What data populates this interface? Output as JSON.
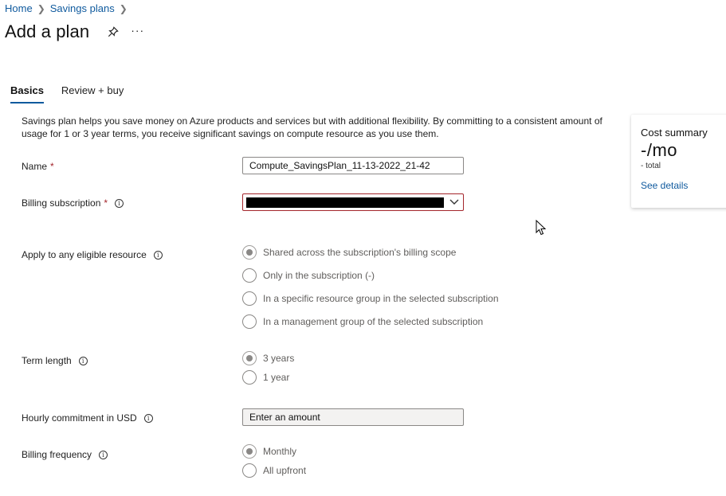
{
  "breadcrumb": [
    {
      "label": "Home"
    },
    {
      "label": "Savings plans"
    }
  ],
  "page": {
    "title": "Add a plan",
    "pin_icon": "pin-icon",
    "more_icon": "more-icon",
    "more_label": "···"
  },
  "tabs": [
    {
      "label": "Basics",
      "active": true
    },
    {
      "label": "Review + buy",
      "active": false
    }
  ],
  "intro": "Savings plan helps you save money on Azure products and services but with additional flexibility. By committing to a consistent amount of usage for 1 or 3 year terms, you receive significant savings on compute resource as you use them.",
  "form": {
    "name": {
      "label": "Name",
      "required_mark": "*",
      "value": "Compute_SavingsPlan_11-13-2022_21-42"
    },
    "billing_subscription": {
      "label": "Billing subscription",
      "required_mark": "*",
      "info_icon": "i",
      "value_redacted": true
    },
    "apply_scope": {
      "label": "Apply to any eligible resource",
      "info_icon": "i",
      "options": [
        {
          "label": "Shared across the subscription's billing scope",
          "checked": true
        },
        {
          "label": "Only in the subscription (-)",
          "checked": false
        },
        {
          "label": "In a specific resource group in the selected subscription",
          "checked": false
        },
        {
          "label": "In a management group of the selected subscription",
          "checked": false
        }
      ]
    },
    "term_length": {
      "label": "Term length",
      "info_icon": "i",
      "options": [
        {
          "label": "3 years",
          "checked": true
        },
        {
          "label": "1 year",
          "checked": false
        }
      ]
    },
    "hourly_commitment": {
      "label": "Hourly commitment in USD",
      "info_icon": "i",
      "placeholder": "Enter an amount"
    },
    "billing_frequency": {
      "label": "Billing frequency",
      "info_icon": "i",
      "options": [
        {
          "label": "Monthly",
          "checked": true
        },
        {
          "label": "All upfront",
          "checked": false
        }
      ]
    }
  },
  "cost_summary": {
    "title": "Cost summary",
    "value": "-/mo",
    "subtext": "- total",
    "link": "See details"
  },
  "colors": {
    "link": "#0f5a9e",
    "required": "#a4262c",
    "error_border": "#a4262c"
  }
}
